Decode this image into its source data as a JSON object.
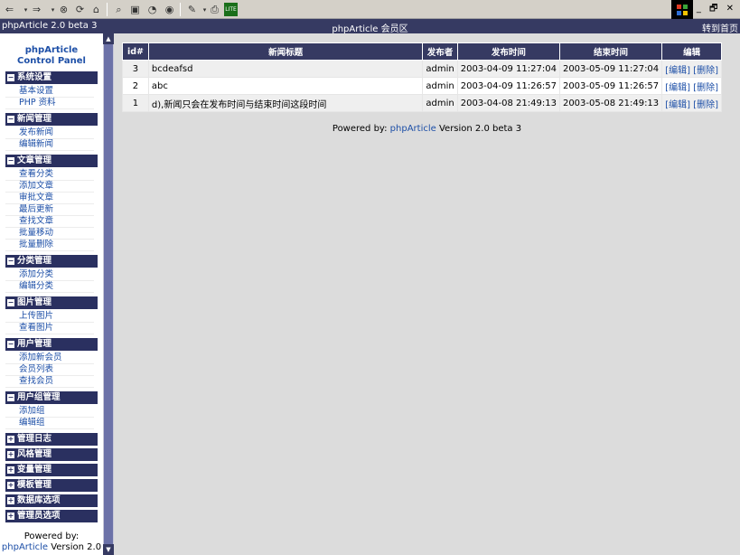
{
  "window": {
    "title_left": "phpArticle 2.0 beta 3",
    "title_center": "phpArticle 会员区",
    "title_right": "转到首页"
  },
  "toolbar": {
    "icons": [
      "back-icon",
      "forward-icon",
      "stop-icon",
      "refresh-icon",
      "home-icon",
      "search-icon",
      "favorites-icon",
      "history-icon",
      "media-icon",
      "edit-icon",
      "print-icon",
      "lite-icon"
    ],
    "window_controls": "_ 🗗 ✕"
  },
  "sidebar": {
    "title_line1": "phpArticle",
    "title_line2": "Control Panel",
    "groups": [
      {
        "label": "系统设置",
        "toggle": "−",
        "items": [
          "基本设置",
          "PHP 资料"
        ]
      },
      {
        "label": "新闻管理",
        "toggle": "−",
        "items": [
          "发布新闻",
          "编辑新闻"
        ]
      },
      {
        "label": "文章管理",
        "toggle": "−",
        "items": [
          "查看分类",
          "添加文章",
          "审批文章",
          "最后更新",
          "查找文章",
          "批量移动",
          "批量删除"
        ]
      },
      {
        "label": "分类管理",
        "toggle": "−",
        "items": [
          "添加分类",
          "编辑分类"
        ]
      },
      {
        "label": "图片管理",
        "toggle": "−",
        "items": [
          "上传图片",
          "查看图片"
        ]
      },
      {
        "label": "用户管理",
        "toggle": "−",
        "items": [
          "添加新会员",
          "会员列表",
          "查找会员"
        ]
      },
      {
        "label": "用户组管理",
        "toggle": "−",
        "items": [
          "添加组",
          "编辑组"
        ]
      },
      {
        "label": "管理日志",
        "toggle": "+",
        "items": []
      },
      {
        "label": "风格管理",
        "toggle": "+",
        "items": []
      },
      {
        "label": "变量管理",
        "toggle": "+",
        "items": []
      },
      {
        "label": "模板管理",
        "toggle": "+",
        "items": []
      },
      {
        "label": "数据库选项",
        "toggle": "+",
        "items": []
      },
      {
        "label": "管理员选项",
        "toggle": "+",
        "items": []
      }
    ],
    "footer_line1": "Powered by:",
    "footer_link": "phpArticle",
    "footer_version": " Version 2.0"
  },
  "table": {
    "headers": [
      "id#",
      "新闻标题",
      "发布者",
      "发布时间",
      "结束时间",
      "编辑"
    ],
    "rows": [
      {
        "id": "3",
        "title": "bcdeafsd",
        "author": "admin",
        "start": "2003-04-09 11:27:04",
        "end": "2003-05-09 11:27:04",
        "edit": "[编辑]",
        "delete": "[删除]"
      },
      {
        "id": "2",
        "title": "abc",
        "author": "admin",
        "start": "2003-04-09 11:26:57",
        "end": "2003-05-09 11:26:57",
        "edit": "[编辑]",
        "delete": "[删除]"
      },
      {
        "id": "1",
        "title": "d),新闻只会在发布时间与结束时间这段时间",
        "author": "admin",
        "start": "2003-04-08 21:49:13",
        "end": "2003-05-08 21:49:13",
        "edit": "[编辑]",
        "delete": "[删除]"
      }
    ]
  },
  "footer": {
    "prefix": "Powered by: ",
    "link": "phpArticle",
    "suffix": " Version 2.0 beta 3"
  },
  "colors": {
    "header": "#363a62",
    "link": "#1d4fa7",
    "background": "#dcdcdc"
  }
}
